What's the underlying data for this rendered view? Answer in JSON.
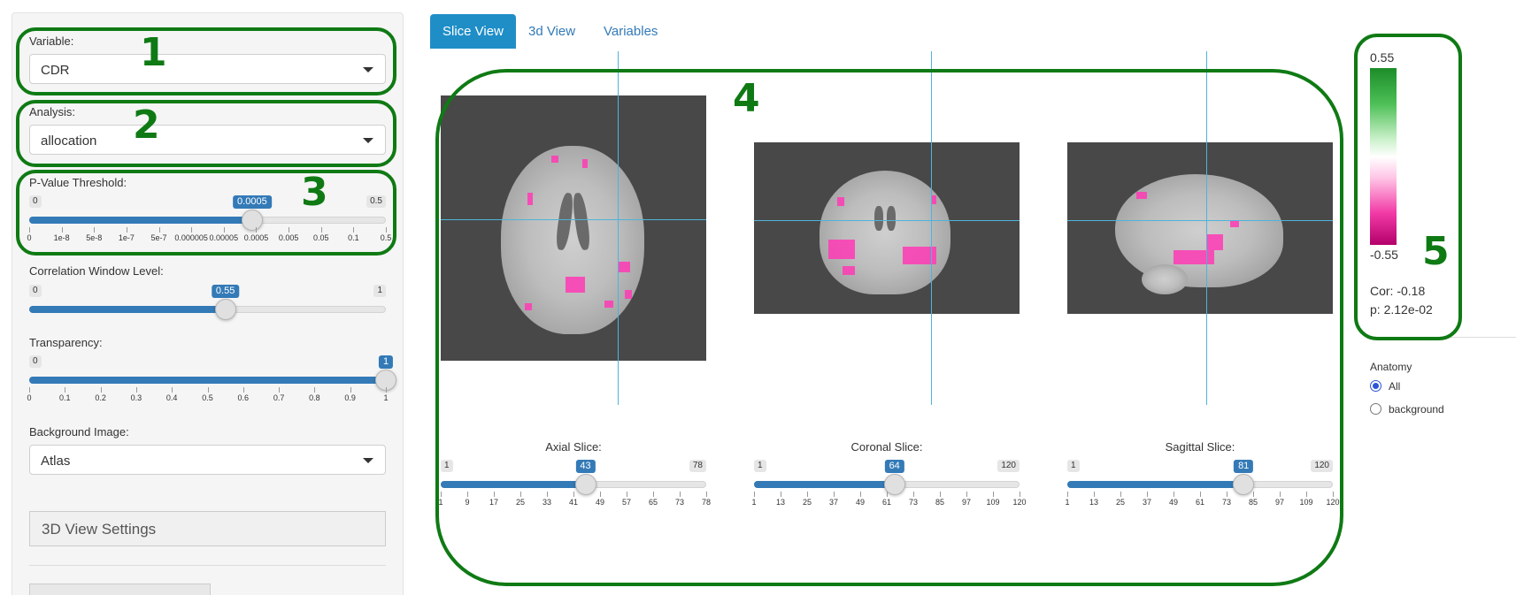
{
  "sidebar": {
    "variable": {
      "label": "Variable:",
      "value": "CDR"
    },
    "analysis": {
      "label": "Analysis:",
      "value": "allocation"
    },
    "pvalue": {
      "label": "P-Value Threshold:",
      "min": "0",
      "max": "0.5",
      "value": "0.0005",
      "fraction": 0.625,
      "ticks": [
        "0",
        "1e-8",
        "5e-8",
        "1e-7",
        "5e-7",
        "0.000005",
        "0.00005",
        "0.0005",
        "0.005",
        "0.05",
        "0.1",
        "0.5"
      ]
    },
    "correlation": {
      "label": "Correlation Window Level:",
      "min": "0",
      "max": "1",
      "value": "0.55",
      "fraction": 0.55
    },
    "transparency": {
      "label": "Transparency:",
      "min": "0",
      "value": "1",
      "fraction": 1.0,
      "ticks": [
        "0",
        "0.1",
        "0.2",
        "0.3",
        "0.4",
        "0.5",
        "0.6",
        "0.7",
        "0.8",
        "0.9",
        "1"
      ]
    },
    "background": {
      "label": "Background Image:",
      "value": "Atlas"
    },
    "settings_button": "3D View Settings"
  },
  "tabs": [
    {
      "label": "Slice View",
      "active": true
    },
    {
      "label": "3d View",
      "active": false
    },
    {
      "label": "Variables",
      "active": false
    }
  ],
  "slices": {
    "axial": {
      "label": "Axial Slice:",
      "min": "1",
      "max": "78",
      "value": "43",
      "fraction": 0.545,
      "ticks": [
        "1",
        "9",
        "17",
        "25",
        "33",
        "41",
        "49",
        "57",
        "65",
        "73",
        "78"
      ]
    },
    "coronal": {
      "label": "Coronal Slice:",
      "min": "1",
      "max": "120",
      "value": "64",
      "fraction": 0.529,
      "ticks": [
        "1",
        "13",
        "25",
        "37",
        "49",
        "61",
        "73",
        "85",
        "97",
        "109",
        "120"
      ]
    },
    "sagittal": {
      "label": "Sagittal Slice:",
      "min": "1",
      "max": "120",
      "value": "81",
      "fraction": 0.664,
      "ticks": [
        "1",
        "13",
        "25",
        "37",
        "49",
        "61",
        "73",
        "85",
        "97",
        "109",
        "120"
      ]
    }
  },
  "colorbar": {
    "max": "0.55",
    "min": "-0.55",
    "cor": "Cor: -0.18",
    "p": "p: 2.12e-02",
    "top_color": "#1c8c29",
    "bottom_color": "#b3006b"
  },
  "anatomy": {
    "label": "Anatomy",
    "options": [
      {
        "label": "All",
        "selected": true
      },
      {
        "label": "background",
        "selected": false
      }
    ]
  },
  "annotations": [
    "1",
    "2",
    "3",
    "4",
    "5"
  ]
}
